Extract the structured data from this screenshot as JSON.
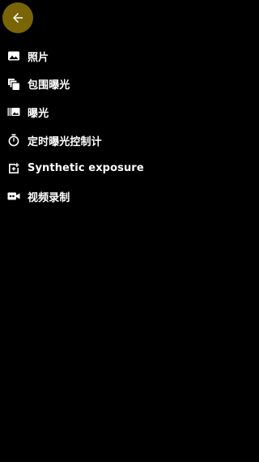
{
  "theme": {
    "background": "#000000",
    "accent": "#7a6506",
    "text": "#ffffff"
  },
  "header": {
    "back_icon": "arrow-left-icon"
  },
  "menu": {
    "items": [
      {
        "label": "照片",
        "icon": "photo-icon"
      },
      {
        "label": "包围曝光",
        "icon": "bracket-exposure-icon"
      },
      {
        "label": "曝光",
        "icon": "exposure-icon"
      },
      {
        "label": "定时曝光控制计",
        "icon": "timer-icon"
      },
      {
        "label": "Synthetic exposure",
        "icon": "synthetic-exposure-icon"
      },
      {
        "label": "视频录制",
        "icon": "video-camera-icon"
      }
    ]
  }
}
